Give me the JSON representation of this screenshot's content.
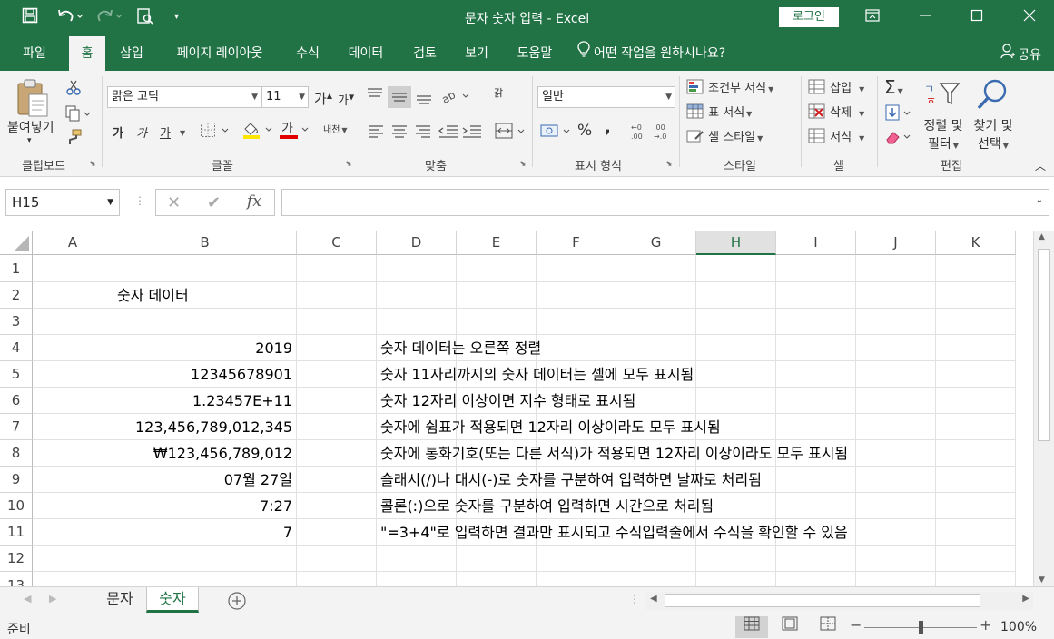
{
  "titlebar": {
    "title": "문자 숫자 입력  -  Excel",
    "login": "로그인"
  },
  "tabs": [
    "파일",
    "홈",
    "삽입",
    "페이지 레이아웃",
    "수식",
    "데이터",
    "검토",
    "보기",
    "도움말"
  ],
  "tell_me": "어떤 작업을 원하시나요?",
  "share": "공유",
  "ribbon": {
    "clipboard": {
      "paste": "붙여넣기",
      "label": "클립보드"
    },
    "font": {
      "name": "맑은 고딕",
      "size": "11",
      "grow": "가",
      "shrink": "가",
      "bold": "가",
      "italic": "가",
      "underline": "가",
      "phonetic": "내천",
      "label": "글꼴"
    },
    "alignment": {
      "wrap": "갉",
      "label": "맞춤"
    },
    "number": {
      "format": "일반",
      "percent": "%",
      "comma": ",",
      "label": "표시 형식"
    },
    "styles": {
      "conditional": "조건부 서식",
      "table": "표 서식",
      "cell": "셀 스타일",
      "label": "스타일"
    },
    "cells": {
      "insert": "삽입",
      "delete": "삭제",
      "format": "서식",
      "label": "셀"
    },
    "editing": {
      "sort_l1": "정렬 및",
      "sort_l2": "필터",
      "find_l1": "찾기 및",
      "find_l2": "선택",
      "label": "편집"
    }
  },
  "formula_bar": {
    "name_box": "H15",
    "fx": "fx",
    "value": ""
  },
  "columns": [
    "A",
    "B",
    "C",
    "D",
    "E",
    "F",
    "G",
    "H",
    "I",
    "J",
    "K"
  ],
  "selected_column": "H",
  "rows": [
    "1",
    "2",
    "3",
    "4",
    "5",
    "6",
    "7",
    "8",
    "9",
    "10",
    "11",
    "12",
    "13"
  ],
  "cells": {
    "B2": "숫자 데이터",
    "B4": "2019",
    "D4": "숫자 데이터는 오른쪽 정렬",
    "B5": "12345678901",
    "D5": "숫자 11자리까지의 숫자 데이터는 셀에 모두 표시됨",
    "B6": "1.23457E+11",
    "D6": "숫자 12자리 이상이면 지수 형태로 표시됨",
    "B7": "123,456,789,012,345",
    "D7": "숫자에 쉼표가 적용되면 12자리 이상이라도 모두 표시됨",
    "B8": "₩123,456,789,012",
    "D8": "숫자에 통화기호(또는 다른 서식)가 적용되면 12자리 이상이라도 모두 표시됨",
    "B9": "07월 27일",
    "D9": "슬래시(/)나 대시(-)로 숫자를 구분하여 입력하면 날짜로 처리됨",
    "B10": "7:27",
    "D10": "콜론(:)으로 숫자를 구분하여 입력하면 시간으로 처리됨",
    "B11": "7",
    "D11": "\"=3+4\"로 입력하면 결과만 표시되고 수식입력줄에서 수식을 확인할 수 있음"
  },
  "sheets": [
    "문자",
    "숫자"
  ],
  "active_sheet": "숫자",
  "status": {
    "mode": "준비",
    "zoom": "100%"
  },
  "colors": {
    "brand": "#217346"
  }
}
